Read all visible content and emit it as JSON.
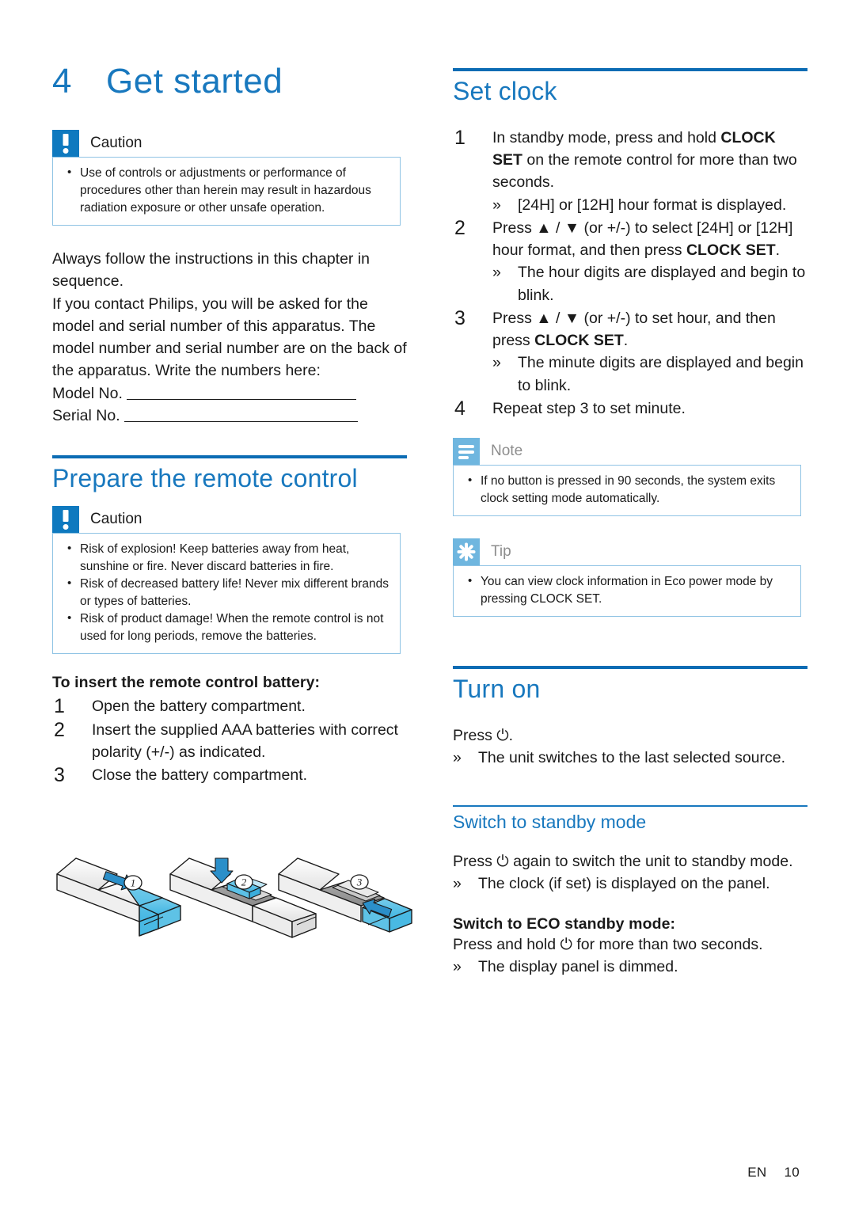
{
  "document": {
    "chapter_number": "4",
    "chapter_title": "Get started",
    "footer_language": "EN",
    "footer_page": "10"
  },
  "colors": {
    "heading_blue": "#1878BE",
    "rule_blue": "#0C6CB4",
    "caution_badge": "#0E79BF",
    "note_badge": "#6FB6DF",
    "callout_border": "#8FC3E4"
  },
  "left_column": {
    "caution_top": {
      "label": "Caution",
      "icon": "exclamation-icon",
      "items": [
        "Use of controls or adjustments or performance of procedures other than herein may result in hazardous radiation exposure or other unsafe operation."
      ]
    },
    "intro_paragraph_1": "Always follow the instructions in this chapter in sequence.",
    "intro_paragraph_2": "If you contact Philips, you will be asked for the model and serial number of this apparatus. The model number and serial number are on the back of the apparatus. Write the numbers here:",
    "model_label": "Model No.",
    "serial_label": "Serial No.",
    "prepare_heading": "Prepare the remote control",
    "caution_battery": {
      "label": "Caution",
      "icon": "exclamation-icon",
      "items": [
        "Risk of explosion! Keep batteries away from heat, sunshine or fire. Never discard batteries in fire.",
        "Risk of decreased battery life! Never mix different brands or types of batteries.",
        "Risk of product damage! When the remote control is not used for long periods, remove the batteries."
      ]
    },
    "insert_battery_heading": "To insert the remote control battery:",
    "insert_steps": [
      {
        "num": "1",
        "text": "Open the battery compartment."
      },
      {
        "num": "2",
        "text": "Insert the supplied AAA batteries with correct polarity (+/-) as indicated."
      },
      {
        "num": "3",
        "text": "Close the battery compartment."
      }
    ],
    "illustration": {
      "name": "remote-control-battery-illustration",
      "callout_1": "1",
      "callout_2": "2",
      "callout_3": "3"
    }
  },
  "right_column": {
    "set_clock_heading": "Set clock",
    "set_clock_steps": [
      {
        "num": "1",
        "text_parts": [
          {
            "t": "In standby mode, press and hold ",
            "b": false
          },
          {
            "t": "CLOCK SET",
            "b": true
          },
          {
            "t": " on the remote control for more than two seconds.",
            "b": false
          }
        ],
        "sub": [
          {
            "marker": "»",
            "text": "[24H] or [12H] hour format is displayed."
          }
        ]
      },
      {
        "num": "2",
        "text_parts": [
          {
            "t": "Press ▲ / ▼ (or +/-) to select [24H] or [12H] hour format, and then press ",
            "b": false
          },
          {
            "t": "CLOCK SET",
            "b": true
          },
          {
            "t": ".",
            "b": false
          }
        ],
        "sub": [
          {
            "marker": "»",
            "text": "The hour digits are displayed and begin to blink."
          }
        ]
      },
      {
        "num": "3",
        "text_parts": [
          {
            "t": "Press ▲ / ▼ (or +/-) to set hour, and then press ",
            "b": false
          },
          {
            "t": "CLOCK SET",
            "b": true
          },
          {
            "t": ".",
            "b": false
          }
        ],
        "sub": [
          {
            "marker": "»",
            "text": "The minute digits are displayed and begin to blink."
          }
        ]
      },
      {
        "num": "4",
        "text_parts": [
          {
            "t": "Repeat step 3 to set minute.",
            "b": false
          }
        ],
        "sub": []
      }
    ],
    "note": {
      "label": "Note",
      "icon": "note-lines-icon",
      "items": [
        "If no button is pressed in 90 seconds, the system exits clock setting mode automatically."
      ]
    },
    "tip": {
      "label": "Tip",
      "icon": "asterisk-icon",
      "items": [
        "You can view clock information in Eco power mode by pressing CLOCK SET."
      ]
    },
    "turn_on_heading": "Turn on",
    "turn_on_press": "Press ⏻.",
    "turn_on_sub": {
      "marker": "»",
      "text": "The unit switches to the last selected source."
    },
    "standby_heading": "Switch to standby mode",
    "standby_press": " Press ⏻ again to switch the unit to standby mode.",
    "standby_sub": {
      "marker": "»",
      "text": "The clock (if set) is displayed on the panel."
    },
    "eco_heading": "Switch to ECO standby mode:",
    "eco_press": "Press and hold ⏻ for more than two seconds.",
    "eco_sub": {
      "marker": "»",
      "text": "The display panel is dimmed."
    }
  }
}
